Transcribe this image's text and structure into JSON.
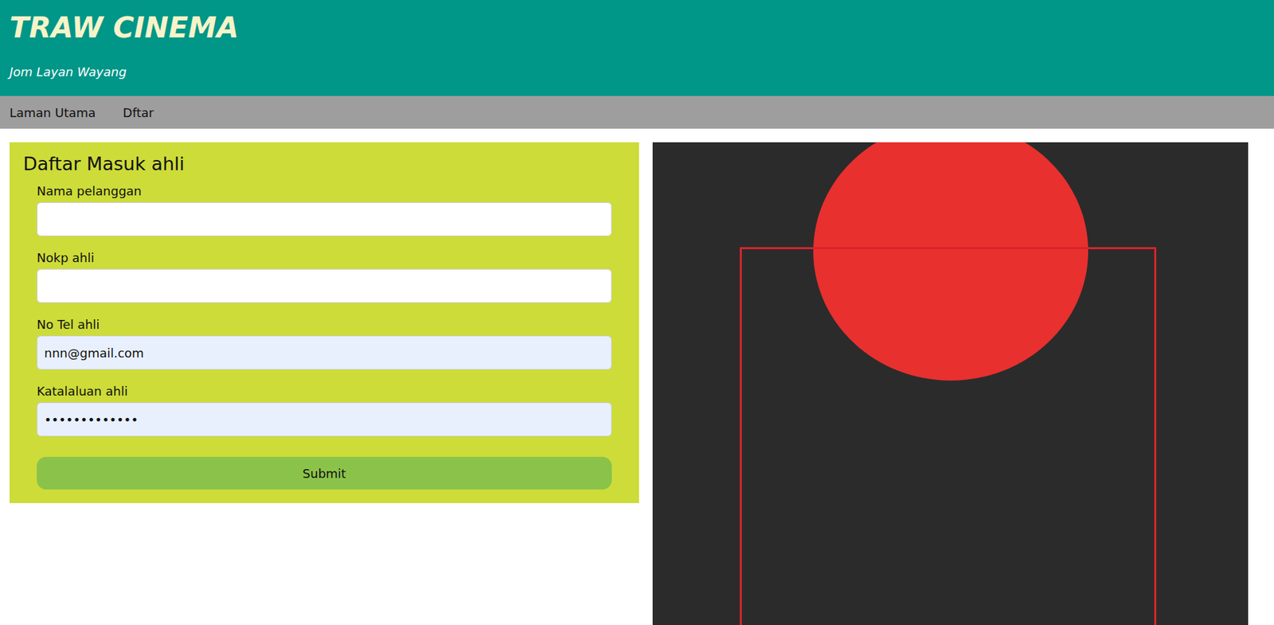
{
  "header": {
    "title": "TRAW CINEMA",
    "subtitle": "Jom Layan Wayang"
  },
  "nav": [
    {
      "label": "Laman Utama"
    },
    {
      "label": "Dftar"
    }
  ],
  "form": {
    "title": "Daftar Masuk ahli",
    "fields": [
      {
        "label": "Nama pelanggan",
        "value": "",
        "autofilled": false
      },
      {
        "label": "Nokp ahli",
        "value": "",
        "autofilled": false
      },
      {
        "label": "No Tel ahli",
        "value": "nnn@gmail.com",
        "autofilled": true
      },
      {
        "label": "Katalaluan ahli",
        "value": "•••••••••••••",
        "autofilled": true
      }
    ],
    "submit": "Submit"
  }
}
